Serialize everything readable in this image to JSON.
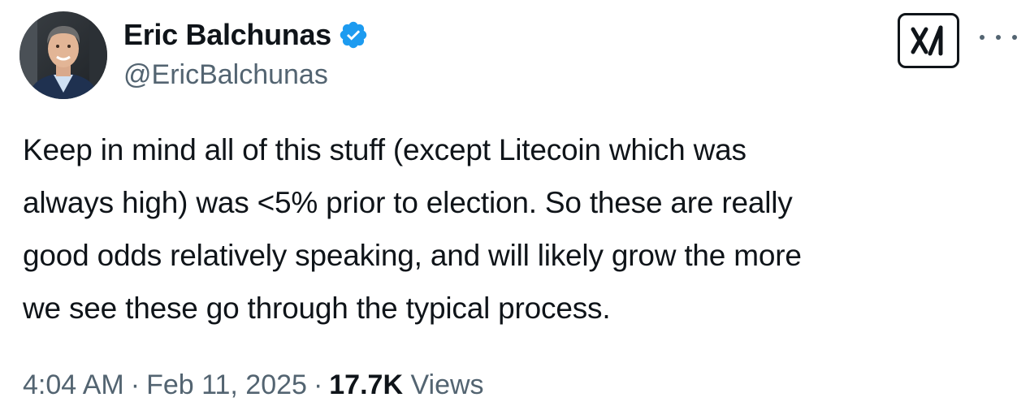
{
  "author": {
    "display_name": "Eric Balchunas",
    "handle": "@EricBalchunas",
    "verified": true,
    "avatar_icon": "profile-photo",
    "verified_icon": "verified-badge-icon"
  },
  "header_actions": {
    "grok_icon": "grok-logo-icon",
    "more_icon": "more-options-icon"
  },
  "tweet": {
    "text_lines": [
      "Keep in mind all of this stuff (except Litecoin which was",
      "always high) was <5% prior to election. So these are really",
      "good odds relatively speaking, and will likely grow the more",
      "we see these go through the typical process."
    ],
    "time": "4:04 AM",
    "separator": "·",
    "date": "Feb 11, 2025",
    "views_count": "17.7K",
    "views_label": "Views"
  },
  "colors": {
    "text_primary": "#0f1419",
    "text_secondary": "#536471",
    "verified_blue": "#1d9bf0"
  }
}
